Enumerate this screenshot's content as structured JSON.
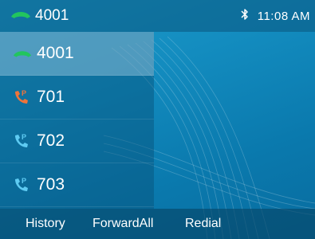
{
  "status_bar": {
    "account": "4001",
    "account_icon": "handset-icon",
    "account_icon_color": "#22c55e",
    "bluetooth_icon": "bluetooth-icon",
    "time": "11:08 AM"
  },
  "lines": [
    {
      "label": "4001",
      "icon": "handset-icon",
      "icon_color": "#22c55e",
      "selected": true
    },
    {
      "label": "701",
      "icon": "blf-phone-icon",
      "icon_color": "#f0743a",
      "selected": false
    },
    {
      "label": "702",
      "icon": "blf-phone-icon",
      "icon_color": "#5ecbf2",
      "selected": false
    },
    {
      "label": "703",
      "icon": "blf-phone-icon",
      "icon_color": "#5ecbf2",
      "selected": false
    }
  ],
  "softkeys": [
    "History",
    "ForwardAll",
    "Redial"
  ],
  "colors": {
    "background": "#138cbf",
    "selected_row": "#7fbedb",
    "text": "#ffffff"
  }
}
